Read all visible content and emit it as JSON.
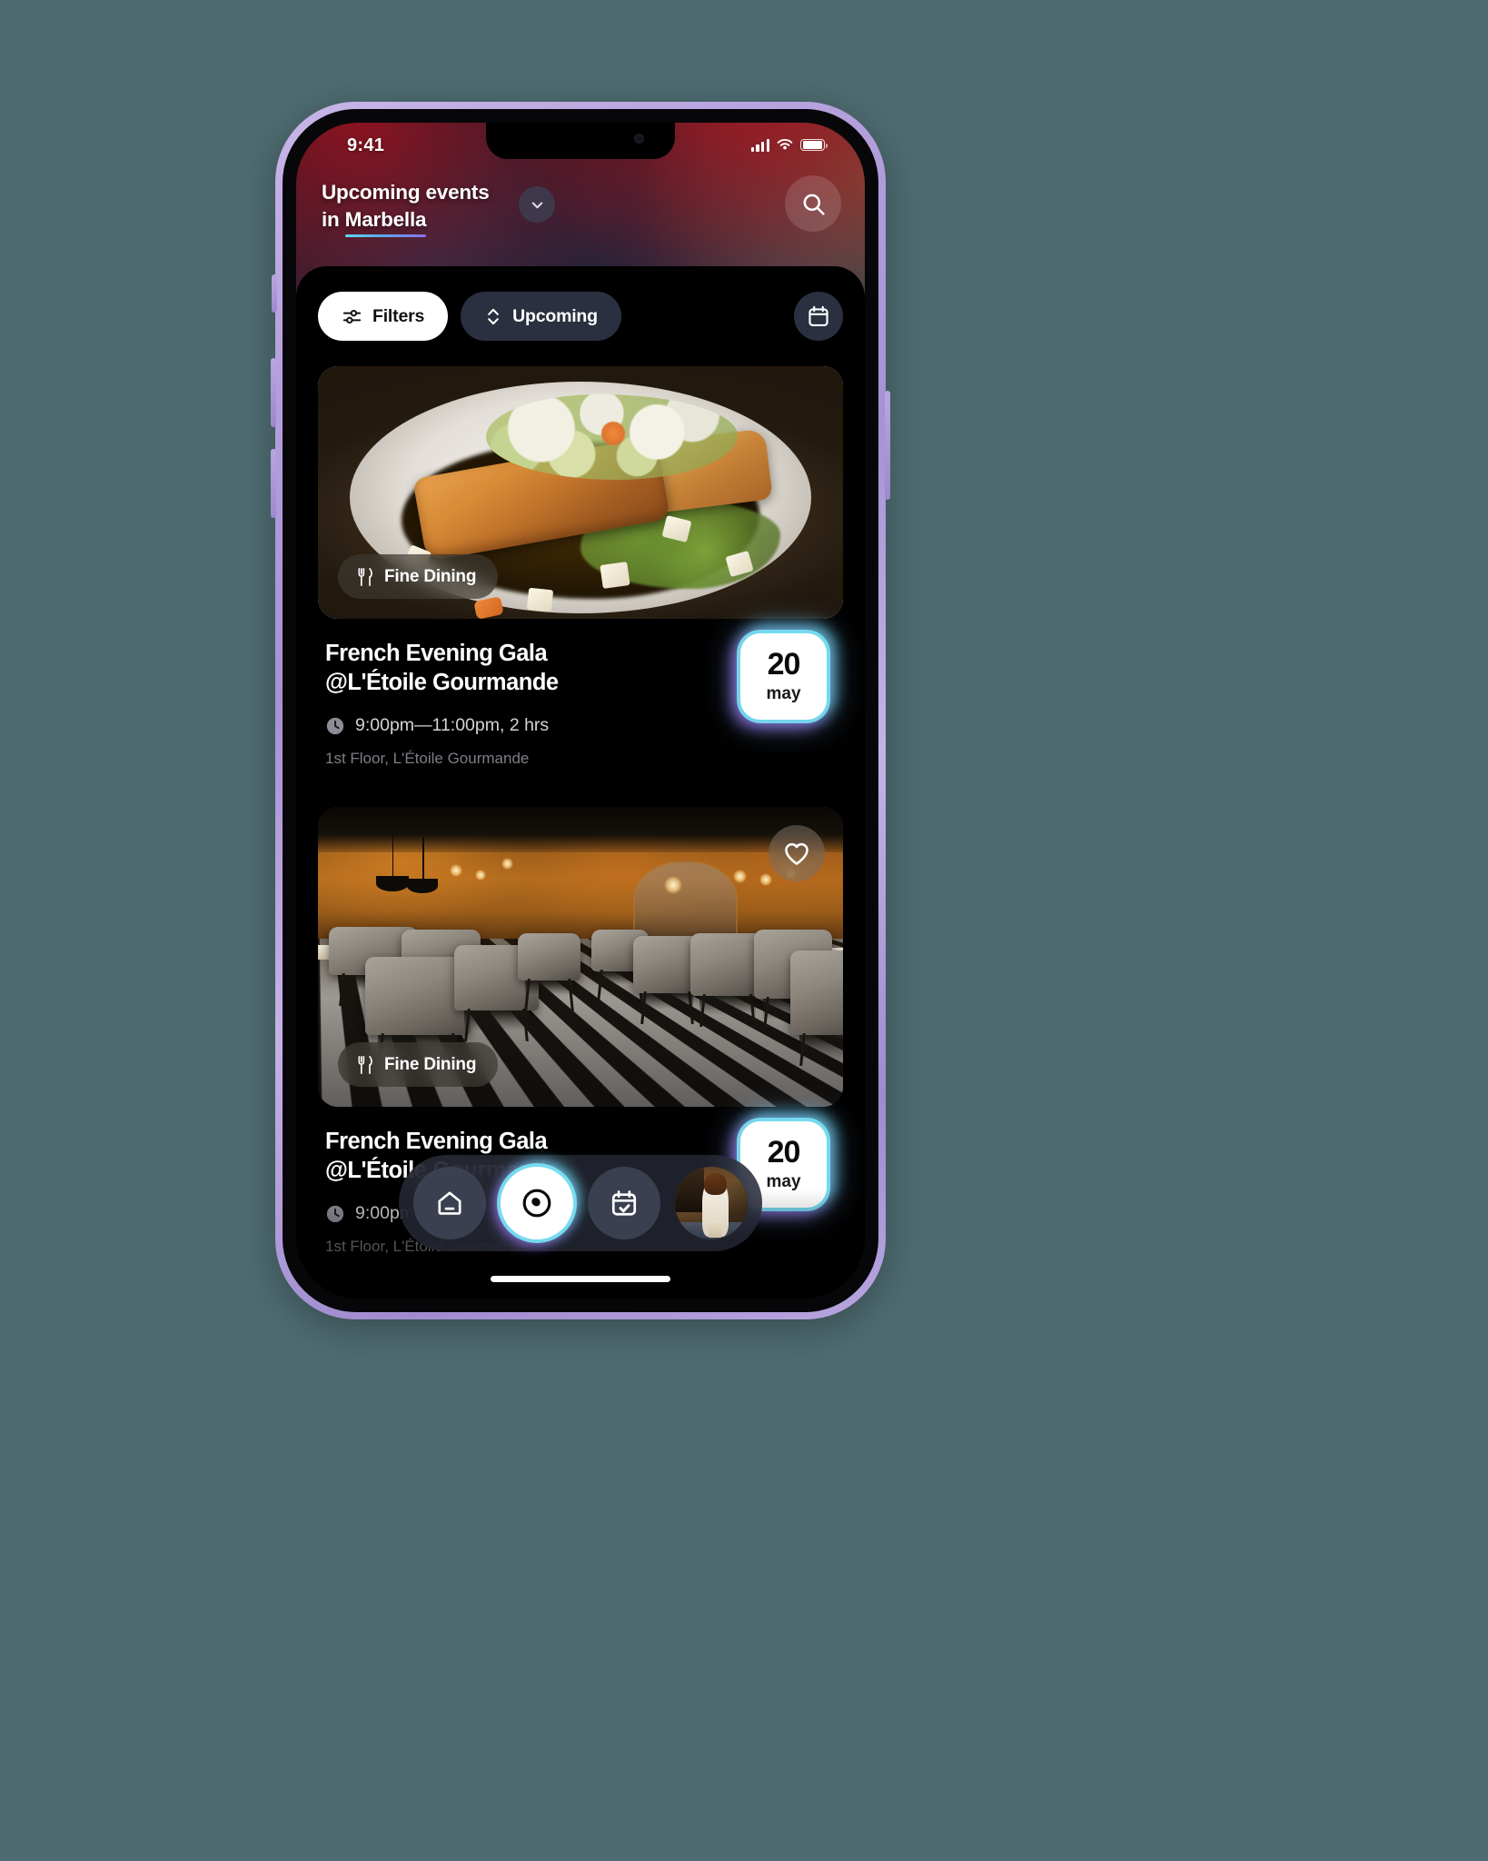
{
  "status_bar": {
    "time": "9:41",
    "signal_icon": "cellular-signal-icon",
    "wifi_icon": "wifi-icon",
    "battery_icon": "battery-icon"
  },
  "header": {
    "title_line1": "Upcoming events",
    "title_line2_prefix": "in ",
    "title_city": "Marbella",
    "chevron_icon": "chevron-down-icon",
    "search_icon": "search-icon",
    "underline_gradient": [
      "#5fd8f5",
      "#57a9f0",
      "#8f6fe8"
    ]
  },
  "toolbar": {
    "filters_label": "Filters",
    "filters_icon": "sliders-icon",
    "sort_label": "Upcoming",
    "sort_icon": "chevron-up-down-icon",
    "calendar_icon": "calendar-icon"
  },
  "events": [
    {
      "category_label": "Fine Dining",
      "category_icon": "fork-knife-icon",
      "title_line1": "French Evening Gala",
      "title_line2": "@L'Étoile Gourmande",
      "time_icon": "clock-icon",
      "time": "9:00pm—11:00pm, 2 hrs",
      "location": "1st Floor, L'Étoile Gourmande",
      "date_day": "20",
      "date_month": "may",
      "image_alt": "plated seared salmon with greens",
      "favorite_icon": null
    },
    {
      "category_label": "Fine Dining",
      "category_icon": "fork-knife-icon",
      "title_line1": "French Evening Gala",
      "title_line2": "@L'Étoile Gourmande",
      "time_icon": "clock-icon",
      "time": "9:00pm—11:00pm, 2 hrs",
      "location": "1st Floor, L'Étoile Gourmande",
      "date_day": "20",
      "date_month": "may",
      "image_alt": "restaurant dining room interior",
      "favorite_icon": "heart-icon"
    }
  ],
  "bottom_nav": {
    "items": [
      {
        "name": "home",
        "icon": "home-icon",
        "active": false
      },
      {
        "name": "explore",
        "icon": "compass-icon",
        "active": true
      },
      {
        "name": "calendar",
        "icon": "calendar-check-icon",
        "active": false
      },
      {
        "name": "profile",
        "icon": "avatar-icon",
        "active": false
      }
    ]
  },
  "colors": {
    "accent_cyan": "#78e6f5",
    "accent_purple": "#966eeb",
    "surface_dark": "#2b3040",
    "background": "#000000",
    "page_background": "#4d6b70",
    "phone_frame": "#b5a0dd"
  }
}
